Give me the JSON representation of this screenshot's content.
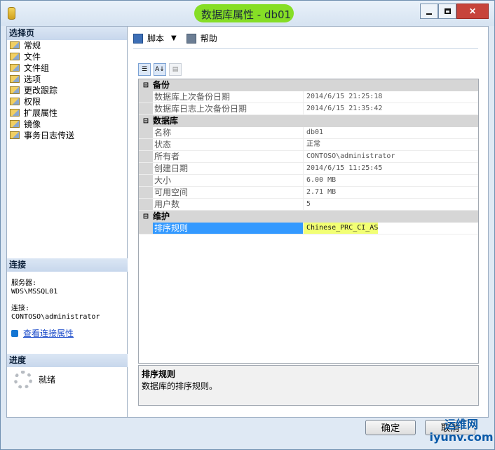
{
  "window": {
    "title": "数据库属性 - db01"
  },
  "sidebar": {
    "header": "选择页",
    "items": [
      "常规",
      "文件",
      "文件组",
      "选项",
      "更改跟踪",
      "权限",
      "扩展属性",
      "镜像",
      "事务日志传送"
    ],
    "connection_header": "连接",
    "server_label": "服务器:",
    "server_value": "WDS\\MSSQL01",
    "connection_label": "连接:",
    "connection_value": "CONTOSO\\administrator",
    "view_connection_link": "查看连接属性",
    "progress_header": "进度",
    "progress_status": "就绪"
  },
  "toolbar": {
    "script_label": "脚本",
    "help_label": "帮助"
  },
  "properties": {
    "backup": {
      "title": "备份",
      "rows": [
        {
          "name": "数据库上次备份日期",
          "value": "2014/6/15 21:25:18"
        },
        {
          "name": "数据库日志上次备份日期",
          "value": "2014/6/15 21:35:42"
        }
      ]
    },
    "database": {
      "title": "数据库",
      "rows": [
        {
          "name": "名称",
          "value": "db01"
        },
        {
          "name": "状态",
          "value": "正常"
        },
        {
          "name": "所有者",
          "value": "CONTOSO\\administrator"
        },
        {
          "name": "创建日期",
          "value": "2014/6/15 11:25:45"
        },
        {
          "name": "大小",
          "value": "6.00 MB"
        },
        {
          "name": "可用空间",
          "value": "2.71 MB"
        },
        {
          "name": "用户数",
          "value": "5"
        }
      ]
    },
    "maintenance": {
      "title": "维护",
      "rows": [
        {
          "name": "排序规则",
          "value": "Chinese_PRC_CI_AS"
        }
      ]
    }
  },
  "description": {
    "title": "排序规则",
    "text": "数据库的排序规则。"
  },
  "buttons": {
    "ok": "确定",
    "cancel": "取消"
  },
  "watermark": {
    "line1": "运维网",
    "line2": "iyunv.com"
  },
  "colors": {
    "title_highlight": "#7edc14",
    "selection": "#3399ff",
    "value_highlight": "#f2ff74"
  }
}
